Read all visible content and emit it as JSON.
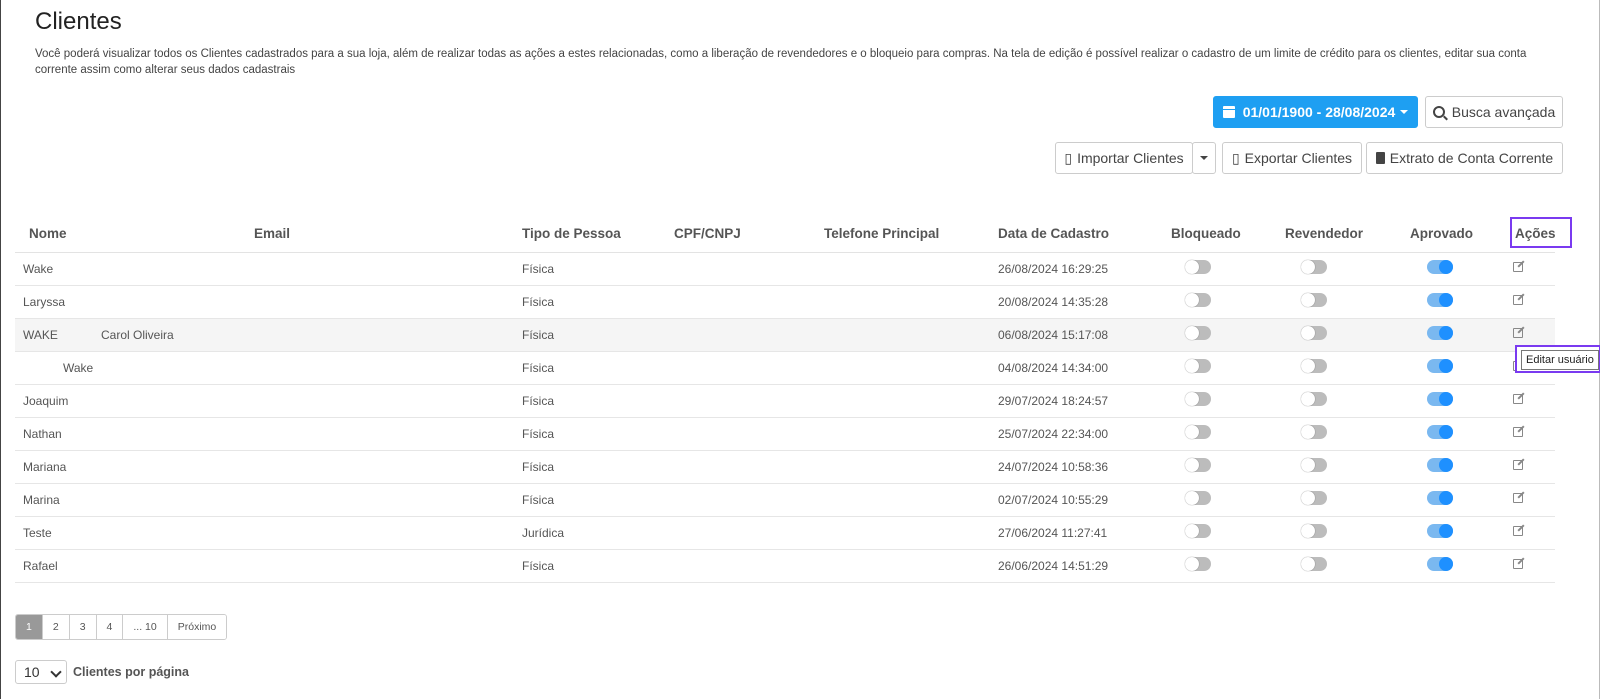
{
  "title": "Clientes",
  "description": "Você poderá visualizar todos os Clientes cadastrados para a sua loja, além de realizar todas as ações a estes relacionadas, como a liberação de revendedores e o bloqueio para compras. Na tela de edição é possível realizar o cadastro de um limite de crédito para os clientes, editar sua conta corrente assim como alterar seus dados cadastrais",
  "toolbar": {
    "date_range": "01/01/1900 - 28/08/2024",
    "busca_avancada": "Busca avançada",
    "importar": "Importar Clientes",
    "exportar": "Exportar Clientes",
    "extrato": "Extrato de Conta Corrente"
  },
  "columns": [
    "Nome",
    "Email",
    "Tipo de Pessoa",
    "CPF/CNPJ",
    "Telefone Principal",
    "Data de Cadastro",
    "Bloqueado",
    "Revendedor",
    "Aprovado",
    "Ações"
  ],
  "rows": [
    {
      "nome": "Wake",
      "nome2": "",
      "tipo": "Física",
      "data": "26/08/2024 16:29:25",
      "bloqueado": false,
      "revendedor": false,
      "aprovado": true
    },
    {
      "nome": "Laryssa",
      "nome2": "",
      "tipo": "Física",
      "data": "20/08/2024 14:35:28",
      "bloqueado": false,
      "revendedor": false,
      "aprovado": true
    },
    {
      "nome": "WAKE",
      "nome2": "Carol Oliveira",
      "tipo": "Física",
      "data": "06/08/2024 15:17:08",
      "bloqueado": false,
      "revendedor": false,
      "aprovado": true
    },
    {
      "nome": "",
      "nome2": "Wake",
      "tipo": "Física",
      "data": "04/08/2024 14:34:00",
      "bloqueado": false,
      "revendedor": false,
      "aprovado": true
    },
    {
      "nome": "Joaquim",
      "nome2": "",
      "tipo": "Física",
      "data": "29/07/2024 18:24:57",
      "bloqueado": false,
      "revendedor": false,
      "aprovado": true
    },
    {
      "nome": "Nathan",
      "nome2": "",
      "tipo": "Física",
      "data": "25/07/2024 22:34:00",
      "bloqueado": false,
      "revendedor": false,
      "aprovado": true
    },
    {
      "nome": "Mariana",
      "nome2": "",
      "tipo": "Física",
      "data": "24/07/2024 10:58:36",
      "bloqueado": false,
      "revendedor": false,
      "aprovado": true
    },
    {
      "nome": "Marina",
      "nome2": "",
      "tipo": "Física",
      "data": "02/07/2024 10:55:29",
      "bloqueado": false,
      "revendedor": false,
      "aprovado": true
    },
    {
      "nome": "Teste",
      "nome2": "",
      "tipo": "Jurídica",
      "data": "27/06/2024 11:27:41",
      "bloqueado": false,
      "revendedor": false,
      "aprovado": true
    },
    {
      "nome": "Rafael",
      "nome2": "",
      "tipo": "Física",
      "data": "26/06/2024 14:51:29",
      "bloqueado": false,
      "revendedor": false,
      "aprovado": true
    }
  ],
  "tooltip": "Editar usuário",
  "pagination": [
    "1",
    "2",
    "3",
    "4",
    "... 10",
    "Próximo"
  ],
  "per_page": {
    "value": "10",
    "label": "Clientes por página"
  },
  "colors": {
    "accent": "#1e9ff2",
    "highlight": "#7a3af0",
    "toggle_on": "#1e90ff"
  }
}
